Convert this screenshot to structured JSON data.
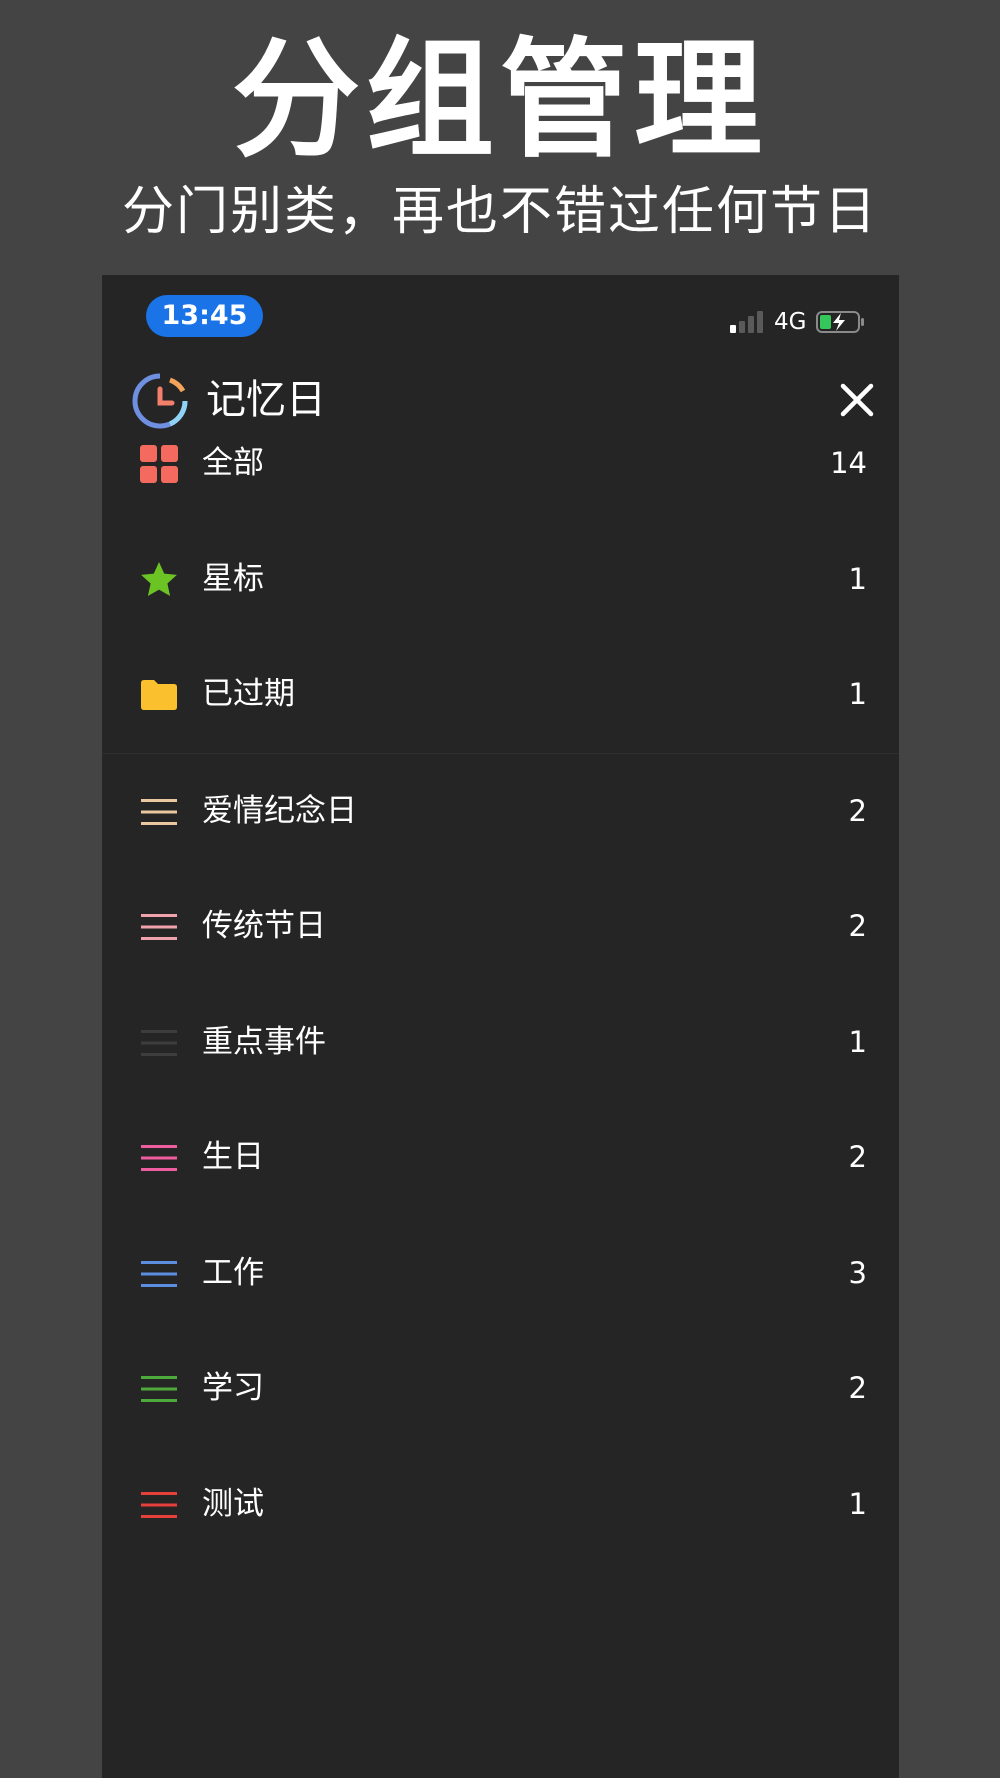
{
  "promo": {
    "title": "分组管理",
    "subtitle": "分门别类，再也不错过任何节日"
  },
  "status_bar": {
    "time": "13:45",
    "network": "4G"
  },
  "header": {
    "app_name": "记忆日"
  },
  "fixed_groups": [
    {
      "label": "全部",
      "count": "14",
      "icon": "grid-icon",
      "color": "#f46a5e"
    },
    {
      "label": "星标",
      "count": "1",
      "icon": "star-icon",
      "color": "#6cc424"
    },
    {
      "label": "已过期",
      "count": "1",
      "icon": "folder-icon",
      "color": "#fbc02d"
    }
  ],
  "custom_groups": [
    {
      "label": "爱情纪念日",
      "count": "2",
      "icon": "lines-icon",
      "color": "#e9c79f"
    },
    {
      "label": "传统节日",
      "count": "2",
      "icon": "lines-icon",
      "color": "#f0a3ad"
    },
    {
      "label": "重点事件",
      "count": "1",
      "icon": "lines-icon",
      "color": "#3d3d3d"
    },
    {
      "label": "生日",
      "count": "2",
      "icon": "lines-icon",
      "color": "#ef5da0"
    },
    {
      "label": "工作",
      "count": "3",
      "icon": "lines-icon",
      "color": "#5b8de0"
    },
    {
      "label": "学习",
      "count": "2",
      "icon": "lines-icon",
      "color": "#4ea93c"
    },
    {
      "label": "测试",
      "count": "1",
      "icon": "lines-icon",
      "color": "#e5403a"
    }
  ]
}
